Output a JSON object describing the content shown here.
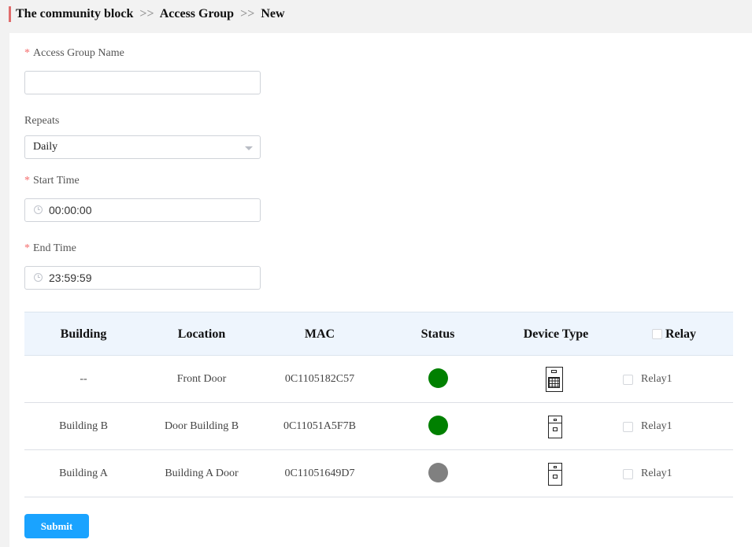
{
  "breadcrumb": {
    "items": [
      "The community block",
      "Access Group",
      "New"
    ],
    "separator": ">>"
  },
  "form": {
    "required_mark": "*",
    "name": {
      "label": "Access Group Name",
      "value": "",
      "placeholder": ""
    },
    "repeats": {
      "label": "Repeats",
      "value": "Daily"
    },
    "start_time": {
      "label": "Start Time",
      "value": "00:00:00"
    },
    "end_time": {
      "label": "End Time",
      "value": "23:59:59"
    }
  },
  "table": {
    "headers": {
      "building": "Building",
      "location": "Location",
      "mac": "MAC",
      "status": "Status",
      "device_type": "Device Type",
      "relay": "Relay"
    },
    "rows": [
      {
        "building": "--",
        "location": "Front Door",
        "mac": "0C1105182C57",
        "status_color": "#008000",
        "device_type_icon": "keypad-door-phone-icon",
        "relay": "Relay1"
      },
      {
        "building": "Building B",
        "location": "Door Building B",
        "mac": "0C11051A5F7B",
        "status_color": "#008000",
        "device_type_icon": "door-phone-icon",
        "relay": "Relay1"
      },
      {
        "building": "Building A",
        "location": "Building A Door",
        "mac": "0C11051649D7",
        "status_color": "#808080",
        "device_type_icon": "door-phone-icon",
        "relay": "Relay1"
      }
    ]
  },
  "submit_label": "Submit"
}
